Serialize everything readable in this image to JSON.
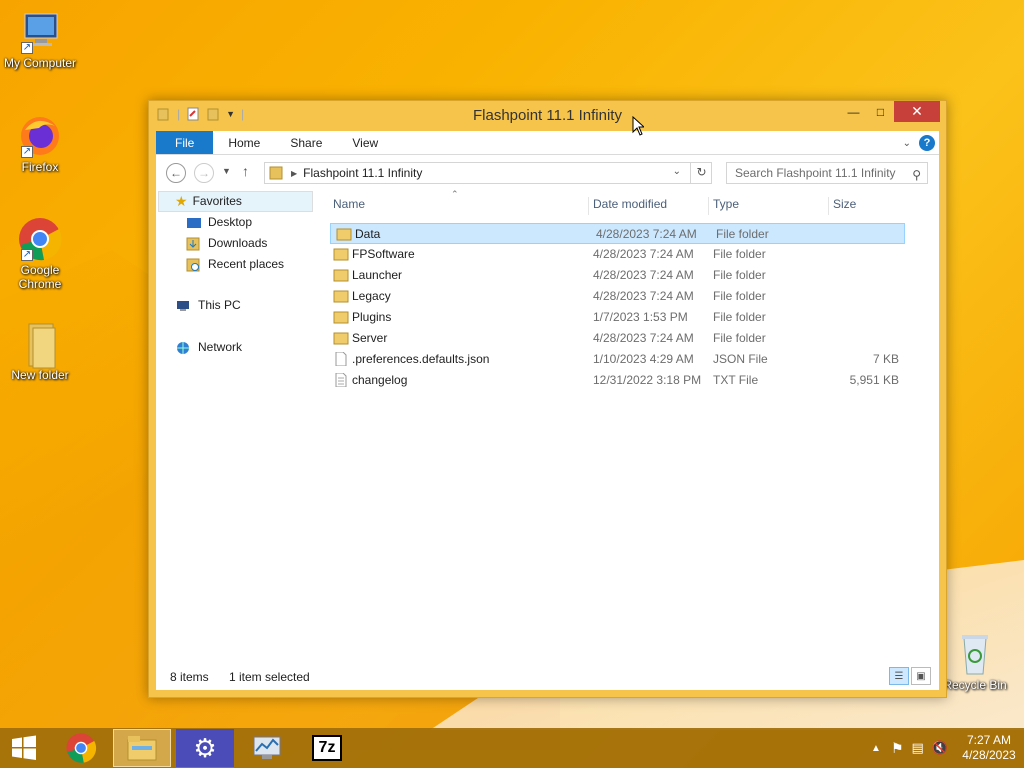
{
  "desktop": {
    "icons": [
      {
        "label": "My Computer"
      },
      {
        "label": "Firefox"
      },
      {
        "label": "Google Chrome"
      },
      {
        "label": "New folder"
      },
      {
        "label": "Recycle Bin"
      }
    ]
  },
  "window": {
    "title": "Flashpoint 11.1 Infinity",
    "ribbon_tabs": [
      "File",
      "Home",
      "Share",
      "View"
    ],
    "address_path": "Flashpoint 11.1 Infinity",
    "search_placeholder": "Search Flashpoint 11.1 Infinity",
    "nav": {
      "favorites": "Favorites",
      "favorites_items": [
        "Desktop",
        "Downloads",
        "Recent places"
      ],
      "this_pc": "This PC",
      "network": "Network"
    },
    "columns": [
      "Name",
      "Date modified",
      "Type",
      "Size"
    ],
    "files": [
      {
        "name": "Data",
        "date": "4/28/2023 7:24 AM",
        "type": "File folder",
        "size": "",
        "icon": "folder-icon",
        "selected": true
      },
      {
        "name": "FPSoftware",
        "date": "4/28/2023 7:24 AM",
        "type": "File folder",
        "size": "",
        "icon": "folder-icon"
      },
      {
        "name": "Launcher",
        "date": "4/28/2023 7:24 AM",
        "type": "File folder",
        "size": "",
        "icon": "folder-icon"
      },
      {
        "name": "Legacy",
        "date": "4/28/2023 7:24 AM",
        "type": "File folder",
        "size": "",
        "icon": "folder-icon"
      },
      {
        "name": "Plugins",
        "date": "1/7/2023 1:53 PM",
        "type": "File folder",
        "size": "",
        "icon": "folder-icon"
      },
      {
        "name": "Server",
        "date": "4/28/2023 7:24 AM",
        "type": "File folder",
        "size": "",
        "icon": "folder-icon"
      },
      {
        "name": ".preferences.defaults.json",
        "date": "1/10/2023 4:29 AM",
        "type": "JSON File",
        "size": "7 KB",
        "icon": "file-icon"
      },
      {
        "name": "changelog",
        "date": "12/31/2022 3:18 PM",
        "type": "TXT File",
        "size": "5,951 KB",
        "icon": "text-file-icon"
      }
    ],
    "status": {
      "items": "8 items",
      "selected": "1 item selected"
    }
  },
  "taskbar": {
    "apps": [
      "chrome-icon",
      "file-explorer-icon",
      "settings-icon",
      "performance-monitor-icon",
      "7zip-icon"
    ],
    "clock_time": "7:27 AM",
    "clock_date": "4/28/2023"
  },
  "colors": {
    "accent": "#1979ca",
    "window_frame": "#f6c44a",
    "selection": "#cce8ff",
    "close": "#c7403a"
  }
}
